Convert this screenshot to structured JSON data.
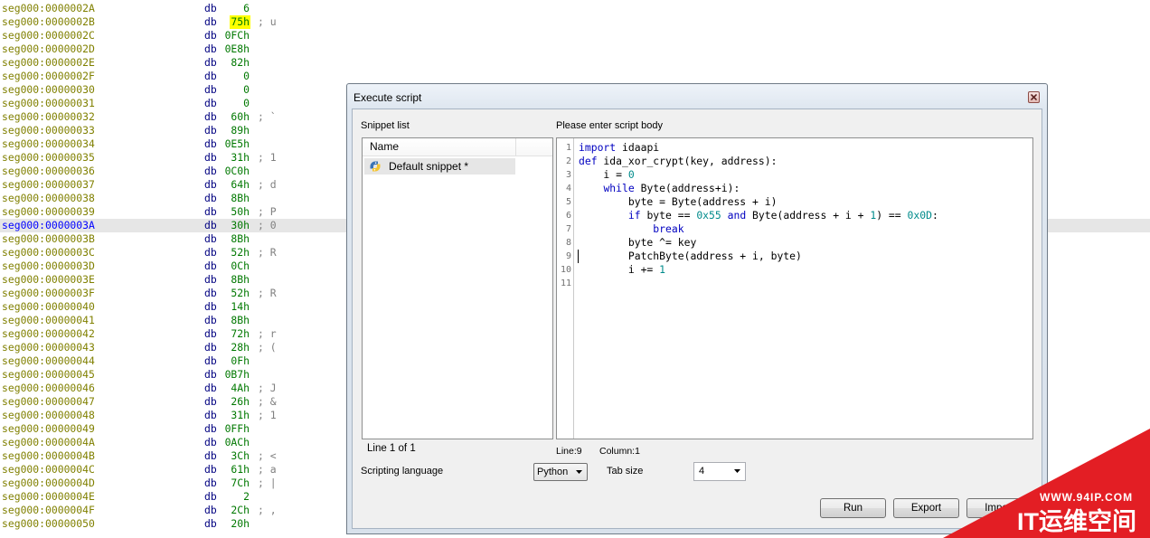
{
  "listing": {
    "current_address": "seg000:0000003A",
    "search_highlight": "75h",
    "rows": [
      [
        "seg000:0000002A",
        "db",
        "6"
      ],
      [
        "seg000:0000002B",
        "db",
        "75h",
        "; u"
      ],
      [
        "seg000:0000002C",
        "db",
        "0FCh"
      ],
      [
        "seg000:0000002D",
        "db",
        "0E8h"
      ],
      [
        "seg000:0000002E",
        "db",
        "82h"
      ],
      [
        "seg000:0000002F",
        "db",
        "0"
      ],
      [
        "seg000:00000030",
        "db",
        "0"
      ],
      [
        "seg000:00000031",
        "db",
        "0"
      ],
      [
        "seg000:00000032",
        "db",
        "60h",
        "; `"
      ],
      [
        "seg000:00000033",
        "db",
        "89h"
      ],
      [
        "seg000:00000034",
        "db",
        "0E5h"
      ],
      [
        "seg000:00000035",
        "db",
        "31h",
        "; 1"
      ],
      [
        "seg000:00000036",
        "db",
        "0C0h"
      ],
      [
        "seg000:00000037",
        "db",
        "64h",
        "; d"
      ],
      [
        "seg000:00000038",
        "db",
        "8Bh"
      ],
      [
        "seg000:00000039",
        "db",
        "50h",
        "; P"
      ],
      [
        "seg000:0000003A",
        "db",
        "30h",
        "; 0"
      ],
      [
        "seg000:0000003B",
        "db",
        "8Bh"
      ],
      [
        "seg000:0000003C",
        "db",
        "52h",
        "; R"
      ],
      [
        "seg000:0000003D",
        "db",
        "0Ch"
      ],
      [
        "seg000:0000003E",
        "db",
        "8Bh"
      ],
      [
        "seg000:0000003F",
        "db",
        "52h",
        "; R"
      ],
      [
        "seg000:00000040",
        "db",
        "14h"
      ],
      [
        "seg000:00000041",
        "db",
        "8Bh"
      ],
      [
        "seg000:00000042",
        "db",
        "72h",
        "; r"
      ],
      [
        "seg000:00000043",
        "db",
        "28h",
        "; ("
      ],
      [
        "seg000:00000044",
        "db",
        "0Fh"
      ],
      [
        "seg000:00000045",
        "db",
        "0B7h"
      ],
      [
        "seg000:00000046",
        "db",
        "4Ah",
        "; J"
      ],
      [
        "seg000:00000047",
        "db",
        "26h",
        "; &"
      ],
      [
        "seg000:00000048",
        "db",
        "31h",
        "; 1"
      ],
      [
        "seg000:00000049",
        "db",
        "0FFh"
      ],
      [
        "seg000:0000004A",
        "db",
        "0ACh"
      ],
      [
        "seg000:0000004B",
        "db",
        "3Ch",
        "; <"
      ],
      [
        "seg000:0000004C",
        "db",
        "61h",
        "; a"
      ],
      [
        "seg000:0000004D",
        "db",
        "7Ch",
        "; |"
      ],
      [
        "seg000:0000004E",
        "db",
        "2"
      ],
      [
        "seg000:0000004F",
        "db",
        "2Ch",
        "; ,"
      ],
      [
        "seg000:00000050",
        "db",
        "20h"
      ]
    ]
  },
  "dialog": {
    "title": "Execute script",
    "close_icon": "close-icon",
    "snippet_list": {
      "label": "Snippet list",
      "column_header": "Name",
      "items": [
        {
          "name": "Default snippet *",
          "icon": "python-icon"
        }
      ],
      "status": "Line 1 of 1"
    },
    "editor": {
      "label": "Please enter script body",
      "line_numbers": [
        "1",
        "2",
        "3",
        "4",
        "5",
        "6",
        "7",
        "8",
        "9",
        "10",
        "11"
      ],
      "lines": [
        [
          {
            "t": "import",
            "k": "kw"
          },
          {
            "t": " idaapi"
          }
        ],
        [
          {
            "t": "def",
            "k": "kw"
          },
          {
            "t": " ida_xor_crypt(key, address):"
          }
        ],
        [
          {
            "t": "    i = "
          },
          {
            "t": "0",
            "k": "num"
          }
        ],
        [
          {
            "t": "    "
          },
          {
            "t": "while",
            "k": "kw"
          },
          {
            "t": " Byte(address+i):"
          }
        ],
        [
          {
            "t": "        byte = Byte(address + i)"
          }
        ],
        [
          {
            "t": "        "
          },
          {
            "t": "if",
            "k": "kw"
          },
          {
            "t": " byte == "
          },
          {
            "t": "0x55",
            "k": "num"
          },
          {
            "t": " "
          },
          {
            "t": "and",
            "k": "kw"
          },
          {
            "t": " Byte(address + i + "
          },
          {
            "t": "1",
            "k": "num"
          },
          {
            "t": ") == "
          },
          {
            "t": "0x0D",
            "k": "num"
          },
          {
            "t": ":"
          }
        ],
        [
          {
            "t": "            "
          },
          {
            "t": "break",
            "k": "kw"
          }
        ],
        [
          {
            "t": "        byte ^= key"
          }
        ],
        [
          {
            "t": "        PatchByte(address + i, byte)"
          }
        ],
        [
          {
            "t": "        i += "
          },
          {
            "t": "1",
            "k": "num"
          }
        ],
        []
      ],
      "cursor_line": "Line:9",
      "cursor_column": "Column:1"
    },
    "language": {
      "label": "Scripting language",
      "value": "Python",
      "icon": "chevron-down-icon"
    },
    "tab_size": {
      "label": "Tab size",
      "value": "4",
      "icon": "chevron-down-icon"
    },
    "buttons": {
      "run": "Run",
      "export": "Export",
      "import": "Import"
    }
  },
  "watermark": {
    "site": "WWW.94IP.COM",
    "name": "IT运维空间"
  },
  "colors": {
    "address": "#808000",
    "address_current": "#0000ff",
    "directive": "#000080",
    "number": "#007800",
    "comment": "#808080",
    "search_highlight": "#ffff00",
    "current_row": "#e6e6e6",
    "code_keyword": "#0000c0",
    "code_number": "#008b8b",
    "watermark": "#e31e24"
  }
}
